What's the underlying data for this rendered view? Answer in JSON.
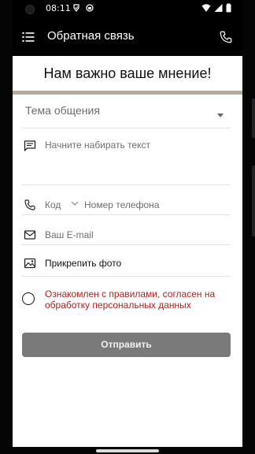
{
  "status_bar": {
    "time": "08:11"
  },
  "app_bar": {
    "title": "Обратная связь"
  },
  "hero": {
    "heading": "Нам важно ваше мнение!"
  },
  "form": {
    "topic_label": "Тема общения",
    "message_placeholder": "Начните набирать текст",
    "code_label": "Код",
    "phone_placeholder": "Номер телефона",
    "email_placeholder": "Ваш E-mail",
    "attach_label": "Прикрепить фото",
    "consent_text": "Ознакомлен с правилами, согласен на обработку персональных данных",
    "submit_label": "Отправить"
  },
  "colors": {
    "app_bar": "#000000",
    "hero_divider": "#b6aa98",
    "consent_text": "#b3201f",
    "submit_button": "#7a7a7a"
  },
  "icons": {
    "menu": "menu-icon",
    "call": "phone-icon",
    "message": "message-icon",
    "phone": "phone-icon",
    "email": "mail-icon",
    "photo": "image-icon"
  }
}
